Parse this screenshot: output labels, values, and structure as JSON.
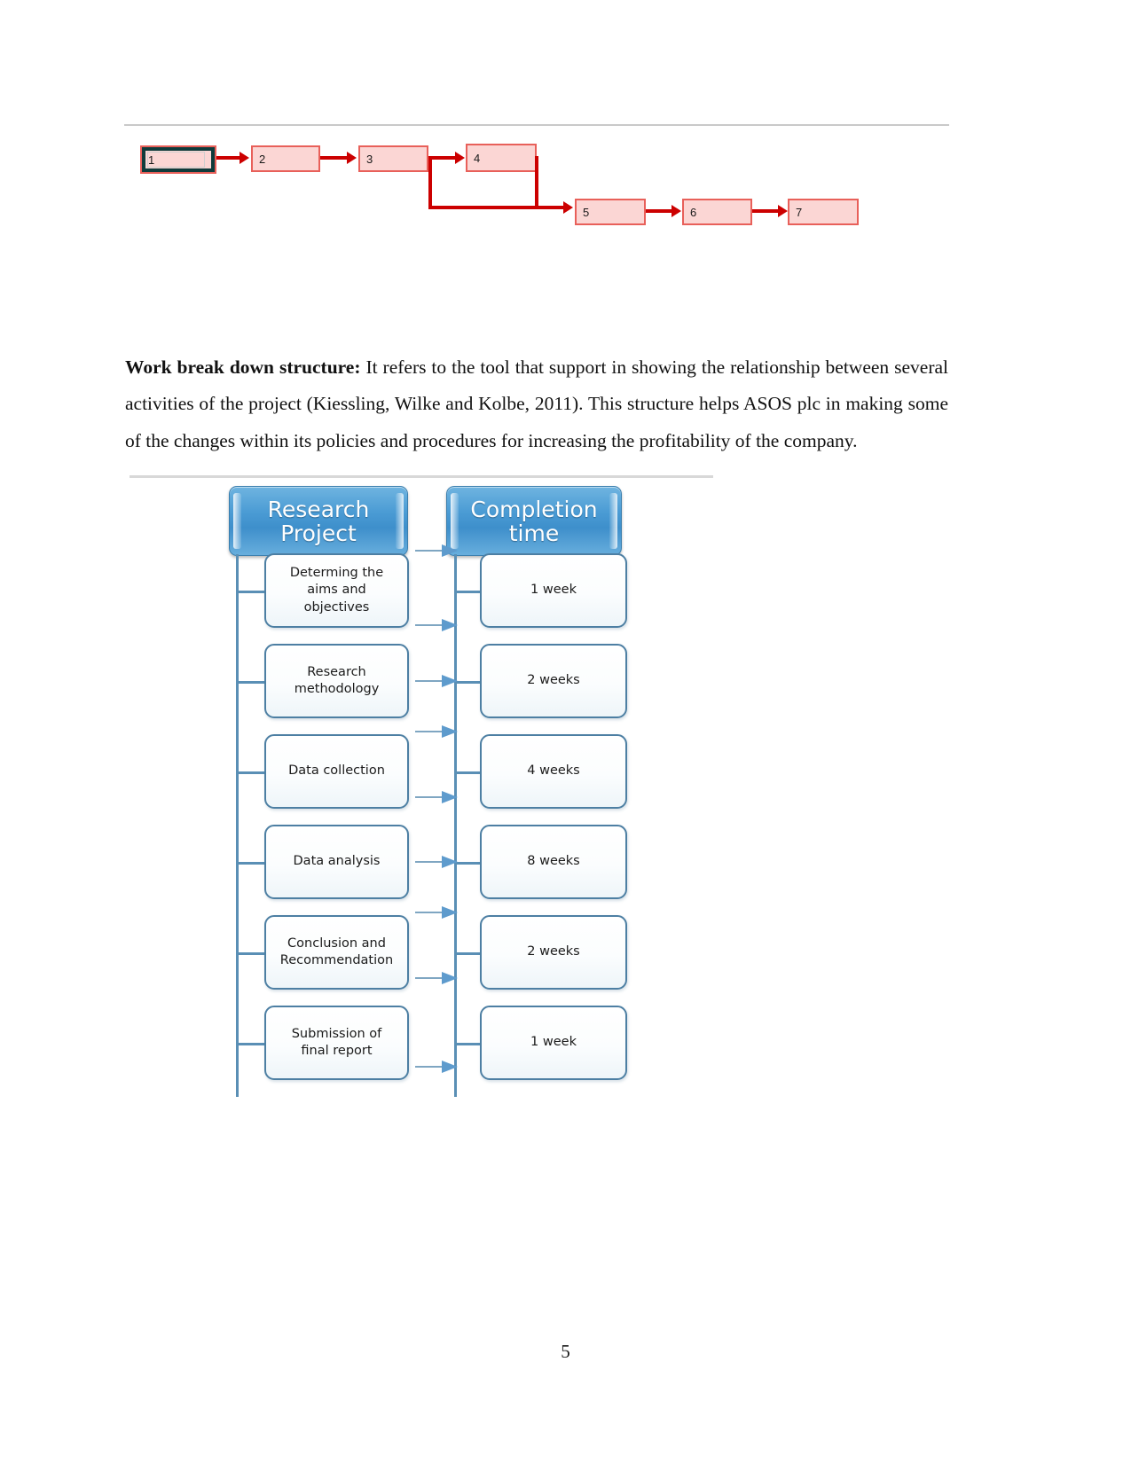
{
  "document": {
    "page_number": "5"
  },
  "network_diagram": {
    "name": "activity-network-diagram",
    "nodes": [
      {
        "label": "1",
        "selected": true
      },
      {
        "label": "2",
        "selected": false
      },
      {
        "label": "3",
        "selected": false
      },
      {
        "label": "4",
        "selected": false
      },
      {
        "label": "5",
        "selected": false
      },
      {
        "label": "6",
        "selected": false
      },
      {
        "label": "7",
        "selected": false
      }
    ],
    "edge_color": "#cc0000",
    "node_fill": "#fbd6d4",
    "node_border": "#e8605a",
    "selection_border": "#0f3b3b"
  },
  "paragraph": {
    "lead": "Work break down structure:",
    "text": " It refers to the tool that support in showing the relationship between several activities of the project (Kiessling, Wilke and Kolbe, 2011). This structure helps ASOS plc in making some of the changes within its policies and procedures for increasing the profitability of the company."
  },
  "wbs": {
    "headers": {
      "left": "Research\nProject",
      "right": "Completion\ntime"
    },
    "accent_color": "#4a9bd4",
    "box_border_color": "#4d7fa3",
    "arrow_color": "#5e9bcd",
    "rows": [
      {
        "task": "Determing the\naims and\nobjectives",
        "time": "1 week"
      },
      {
        "task": "Research\nmethodology",
        "time": "2 weeks"
      },
      {
        "task": "Data collection",
        "time": "4 weeks"
      },
      {
        "task": "Data analysis",
        "time": "8 weeks"
      },
      {
        "task": "Conclusion and\nRecommendation",
        "time": "2 weeks"
      },
      {
        "task": "Submission of\nfinal report",
        "time": "1 week"
      }
    ]
  }
}
